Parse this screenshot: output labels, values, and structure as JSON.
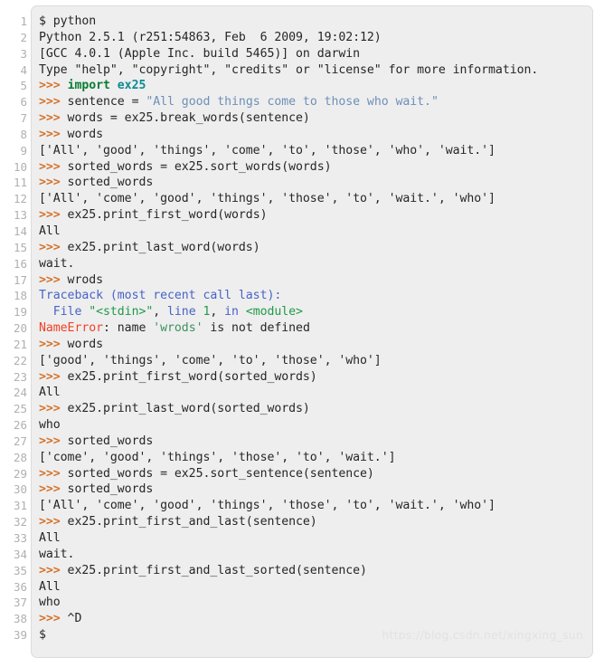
{
  "viewer": {
    "name": "python-repl-session-code-block",
    "total_lines": 39,
    "colors": {
      "background": "#ffffff",
      "panel_background": "#eeeeee",
      "panel_border": "#dcdcdc",
      "line_number": "#b0b0b0",
      "text": "#262626",
      "prompt": "#d4722a",
      "keyword": "#0a7d32",
      "module_name": "#0b8a95",
      "string": "#6f8fb8",
      "traceback_blue": "#4763c8",
      "traceback_green": "#1f9a48",
      "error": "#ef4126",
      "watermark": "#e2e2e2"
    }
  },
  "watermark": {
    "text": "https://blog.csdn.net/xingxing_sun"
  },
  "line_numbers": [
    "1",
    "2",
    "3",
    "4",
    "5",
    "6",
    "7",
    "8",
    "9",
    "10",
    "11",
    "12",
    "13",
    "14",
    "15",
    "16",
    "17",
    "18",
    "19",
    "20",
    "21",
    "22",
    "23",
    "24",
    "25",
    "26",
    "27",
    "28",
    "29",
    "30",
    "31",
    "32",
    "33",
    "34",
    "35",
    "36",
    "37",
    "38",
    "39"
  ],
  "lines": [
    {
      "n": 1,
      "plain": "$ python",
      "tokens": [
        {
          "t": "$ python",
          "c": "plain"
        }
      ]
    },
    {
      "n": 2,
      "plain": "Python 2.5.1 (r251:54863, Feb  6 2009, 19:02:12)",
      "tokens": [
        {
          "t": "Python 2.5.1 (r251:54863, Feb  6 2009, 19:02:12)",
          "c": "plain"
        }
      ]
    },
    {
      "n": 3,
      "plain": "[GCC 4.0.1 (Apple Inc. build 5465)] on darwin",
      "tokens": [
        {
          "t": "[GCC 4.0.1 (Apple Inc. build 5465)] on darwin",
          "c": "plain"
        }
      ]
    },
    {
      "n": 4,
      "plain": "Type \"help\", \"copyright\", \"credits\" or \"license\" for more information.",
      "tokens": [
        {
          "t": "Type \"help\", \"copyright\", \"credits\" or \"license\" for more information.",
          "c": "plain"
        }
      ]
    },
    {
      "n": 5,
      "plain": ">>> import ex25",
      "tokens": [
        {
          "t": ">>>",
          "c": "prompt"
        },
        {
          "t": " ",
          "c": "plain"
        },
        {
          "t": "import",
          "c": "keyword"
        },
        {
          "t": " ",
          "c": "plain"
        },
        {
          "t": "ex25",
          "c": "name"
        }
      ]
    },
    {
      "n": 6,
      "plain": ">>> sentence = \"All good things come to those who wait.\"",
      "tokens": [
        {
          "t": ">>>",
          "c": "prompt"
        },
        {
          "t": " sentence = ",
          "c": "plain"
        },
        {
          "t": "\"All good things come to those who wait.\"",
          "c": "string"
        }
      ]
    },
    {
      "n": 7,
      "plain": ">>> words = ex25.break_words(sentence)",
      "tokens": [
        {
          "t": ">>>",
          "c": "prompt"
        },
        {
          "t": " words = ex25.break_words(sentence)",
          "c": "plain"
        }
      ]
    },
    {
      "n": 8,
      "plain": ">>> words",
      "tokens": [
        {
          "t": ">>>",
          "c": "prompt"
        },
        {
          "t": " words",
          "c": "plain"
        }
      ]
    },
    {
      "n": 9,
      "plain": "['All', 'good', 'things', 'come', 'to', 'those', 'who', 'wait.']",
      "tokens": [
        {
          "t": "['All', 'good', 'things', 'come', 'to', 'those', 'who', 'wait.']",
          "c": "plain"
        }
      ]
    },
    {
      "n": 10,
      "plain": ">>> sorted_words = ex25.sort_words(words)",
      "tokens": [
        {
          "t": ">>>",
          "c": "prompt"
        },
        {
          "t": " sorted_words = ex25.sort_words(words)",
          "c": "plain"
        }
      ]
    },
    {
      "n": 11,
      "plain": ">>> sorted_words",
      "tokens": [
        {
          "t": ">>>",
          "c": "prompt"
        },
        {
          "t": " sorted_words",
          "c": "plain"
        }
      ]
    },
    {
      "n": 12,
      "plain": "['All', 'come', 'good', 'things', 'those', 'to', 'wait.', 'who']",
      "tokens": [
        {
          "t": "['All', 'come', 'good', 'things', 'those', 'to', 'wait.', 'who']",
          "c": "plain"
        }
      ]
    },
    {
      "n": 13,
      "plain": ">>> ex25.print_first_word(words)",
      "tokens": [
        {
          "t": ">>>",
          "c": "prompt"
        },
        {
          "t": " ex25.print_first_word(words)",
          "c": "plain"
        }
      ]
    },
    {
      "n": 14,
      "plain": "All",
      "tokens": [
        {
          "t": "All",
          "c": "plain"
        }
      ]
    },
    {
      "n": 15,
      "plain": ">>> ex25.print_last_word(words)",
      "tokens": [
        {
          "t": ">>>",
          "c": "prompt"
        },
        {
          "t": " ex25.print_last_word(words)",
          "c": "plain"
        }
      ]
    },
    {
      "n": 16,
      "plain": "wait.",
      "tokens": [
        {
          "t": "wait.",
          "c": "plain"
        }
      ]
    },
    {
      "n": 17,
      "plain": ">>> wrods",
      "tokens": [
        {
          "t": ">>>",
          "c": "prompt"
        },
        {
          "t": " wrods",
          "c": "plain"
        }
      ]
    },
    {
      "n": 18,
      "plain": "Traceback (most recent call last):",
      "tokens": [
        {
          "t": "Traceback (most recent call last):",
          "c": "tbblue"
        }
      ]
    },
    {
      "n": 19,
      "plain": "  File \"<stdin>\", line 1, in <module>",
      "tokens": [
        {
          "t": "  ",
          "c": "plain"
        },
        {
          "t": "File ",
          "c": "tbblue"
        },
        {
          "t": "\"<stdin>\"",
          "c": "tbgreen"
        },
        {
          "t": ", ",
          "c": "plain"
        },
        {
          "t": "line ",
          "c": "tbblue"
        },
        {
          "t": "1",
          "c": "tbgreen"
        },
        {
          "t": ", ",
          "c": "plain"
        },
        {
          "t": "in ",
          "c": "tbblue"
        },
        {
          "t": "<module>",
          "c": "tbgreen"
        }
      ]
    },
    {
      "n": 20,
      "plain": "NameError: name 'wrods' is not defined",
      "tokens": [
        {
          "t": "NameError",
          "c": "error"
        },
        {
          "t": ": name ",
          "c": "plain"
        },
        {
          "t": "'wrods'",
          "c": "errgreen"
        },
        {
          "t": " is not defined",
          "c": "plain"
        }
      ]
    },
    {
      "n": 21,
      "plain": ">>> words",
      "tokens": [
        {
          "t": ">>>",
          "c": "prompt"
        },
        {
          "t": " words",
          "c": "plain"
        }
      ]
    },
    {
      "n": 22,
      "plain": "['good', 'things', 'come', 'to', 'those', 'who']",
      "tokens": [
        {
          "t": "['good', 'things', 'come', 'to', 'those', 'who']",
          "c": "plain"
        }
      ]
    },
    {
      "n": 23,
      "plain": ">>> ex25.print_first_word(sorted_words)",
      "tokens": [
        {
          "t": ">>>",
          "c": "prompt"
        },
        {
          "t": " ex25.print_first_word(sorted_words)",
          "c": "plain"
        }
      ]
    },
    {
      "n": 24,
      "plain": "All",
      "tokens": [
        {
          "t": "All",
          "c": "plain"
        }
      ]
    },
    {
      "n": 25,
      "plain": ">>> ex25.print_last_word(sorted_words)",
      "tokens": [
        {
          "t": ">>>",
          "c": "prompt"
        },
        {
          "t": " ex25.print_last_word(sorted_words)",
          "c": "plain"
        }
      ]
    },
    {
      "n": 26,
      "plain": "who",
      "tokens": [
        {
          "t": "who",
          "c": "plain"
        }
      ]
    },
    {
      "n": 27,
      "plain": ">>> sorted_words",
      "tokens": [
        {
          "t": ">>>",
          "c": "prompt"
        },
        {
          "t": " sorted_words",
          "c": "plain"
        }
      ]
    },
    {
      "n": 28,
      "plain": "['come', 'good', 'things', 'those', 'to', 'wait.']",
      "tokens": [
        {
          "t": "['come', 'good', 'things', 'those', 'to', 'wait.']",
          "c": "plain"
        }
      ]
    },
    {
      "n": 29,
      "plain": ">>> sorted_words = ex25.sort_sentence(sentence)",
      "tokens": [
        {
          "t": ">>>",
          "c": "prompt"
        },
        {
          "t": " sorted_words = ex25.sort_sentence(sentence)",
          "c": "plain"
        }
      ]
    },
    {
      "n": 30,
      "plain": ">>> sorted_words",
      "tokens": [
        {
          "t": ">>>",
          "c": "prompt"
        },
        {
          "t": " sorted_words",
          "c": "plain"
        }
      ]
    },
    {
      "n": 31,
      "plain": "['All', 'come', 'good', 'things', 'those', 'to', 'wait.', 'who']",
      "tokens": [
        {
          "t": "['All', 'come', 'good', 'things', 'those', 'to', 'wait.', 'who']",
          "c": "plain"
        }
      ]
    },
    {
      "n": 32,
      "plain": ">>> ex25.print_first_and_last(sentence)",
      "tokens": [
        {
          "t": ">>>",
          "c": "prompt"
        },
        {
          "t": " ex25.print_first_and_last(sentence)",
          "c": "plain"
        }
      ]
    },
    {
      "n": 33,
      "plain": "All",
      "tokens": [
        {
          "t": "All",
          "c": "plain"
        }
      ]
    },
    {
      "n": 34,
      "plain": "wait.",
      "tokens": [
        {
          "t": "wait.",
          "c": "plain"
        }
      ]
    },
    {
      "n": 35,
      "plain": ">>> ex25.print_first_and_last_sorted(sentence)",
      "tokens": [
        {
          "t": ">>>",
          "c": "prompt"
        },
        {
          "t": " ex25.print_first_and_last_sorted(sentence)",
          "c": "plain"
        }
      ]
    },
    {
      "n": 36,
      "plain": "All",
      "tokens": [
        {
          "t": "All",
          "c": "plain"
        }
      ]
    },
    {
      "n": 37,
      "plain": "who",
      "tokens": [
        {
          "t": "who",
          "c": "plain"
        }
      ]
    },
    {
      "n": 38,
      "plain": ">>> ^D",
      "tokens": [
        {
          "t": ">>>",
          "c": "prompt"
        },
        {
          "t": " ^D",
          "c": "plain"
        }
      ]
    },
    {
      "n": 39,
      "plain": "$",
      "tokens": [
        {
          "t": "$",
          "c": "plain"
        }
      ]
    }
  ]
}
